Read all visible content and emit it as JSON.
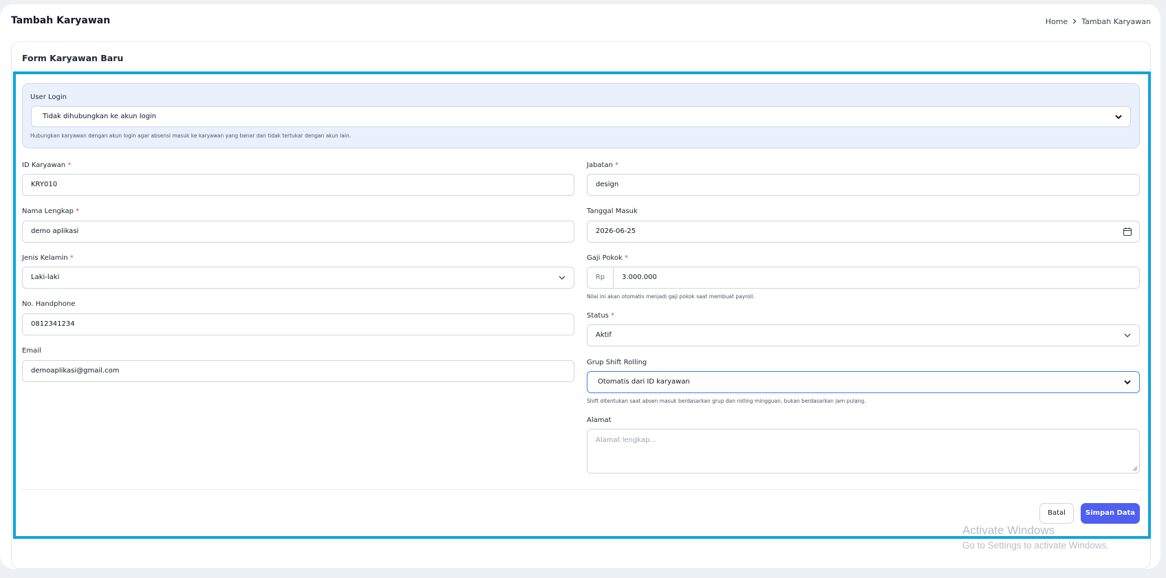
{
  "header": {
    "title": "Tambah Karyawan",
    "breadcrumb": {
      "home": "Home",
      "current": "Tambah Karyawan"
    }
  },
  "form": {
    "title": "Form Karyawan Baru",
    "user_login": {
      "label": "User Login",
      "value": "Tidak dihubungkan ke akun login",
      "help": "Hubungkan karyawan dengan akun login agar absensi masuk ke karyawan yang benar dan tidak tertukar dengan akun lain."
    },
    "id_karyawan": {
      "label": "ID Karyawan",
      "value": "KRY010"
    },
    "nama_lengkap": {
      "label": "Nama Lengkap",
      "value": "demo aplikasi"
    },
    "jenis_kelamin": {
      "label": "Jenis Kelamin",
      "value": "Laki-laki"
    },
    "no_handphone": {
      "label": "No. Handphone",
      "value": "0812341234"
    },
    "email": {
      "label": "Email",
      "value": "demoaplikasi@gmail.com"
    },
    "jabatan": {
      "label": "Jabatan",
      "value": "design"
    },
    "tanggal_masuk": {
      "label": "Tanggal Masuk",
      "value": "2026-06-25"
    },
    "gaji_pokok": {
      "label": "Gaji Pokok",
      "prefix": "Rp",
      "value": "3.000.000",
      "help": "Nilai ini akan otomatis menjadi gaji pokok saat membuat payroll."
    },
    "status": {
      "label": "Status",
      "value": "Aktif"
    },
    "grup_shift": {
      "label": "Grup Shift Rolling",
      "value": "Otomatis dari ID karyawan",
      "help": "Shift ditentukan saat absen masuk berdasarkan grup dan rolling mingguan, bukan berdasarkan jam pulang."
    },
    "alamat": {
      "label": "Alamat",
      "placeholder": "Alamat lengkap..."
    },
    "required_mark": "*",
    "buttons": {
      "cancel": "Batal",
      "save": "Simpan Data"
    }
  },
  "watermark": {
    "line1": "Activate Windows",
    "line2": "Go to Settings to activate Windows."
  },
  "colors": {
    "primary": "#4f5ff0",
    "highlight": "#0ea5d9",
    "required": "#ef4444"
  }
}
